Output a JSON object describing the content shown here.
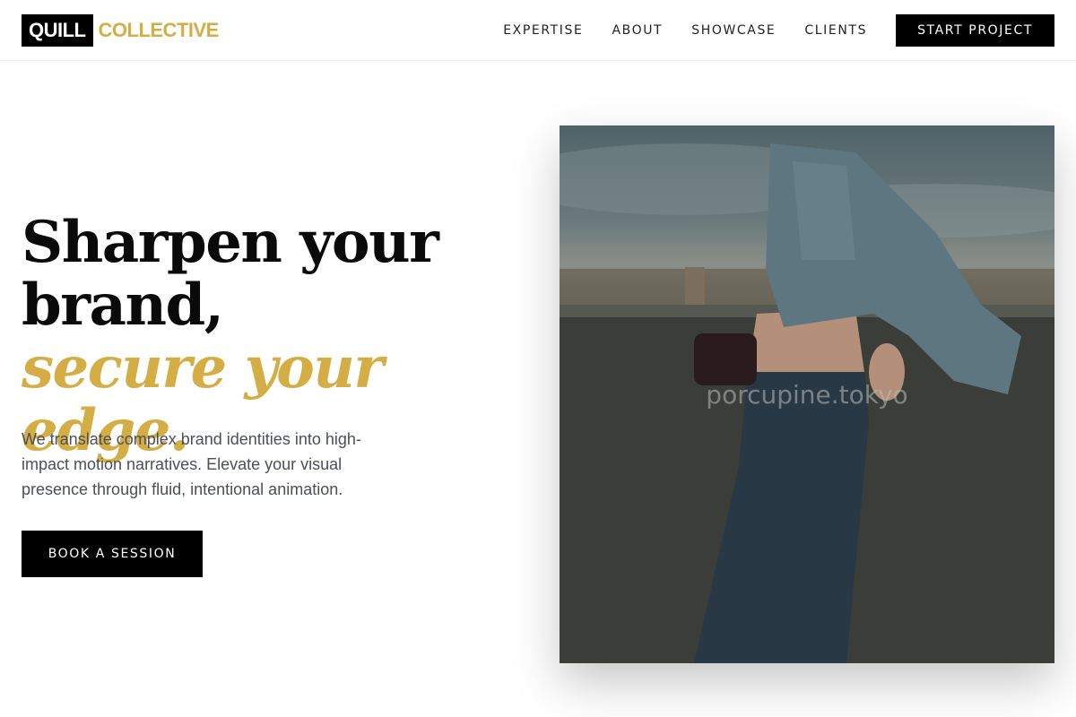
{
  "header": {
    "logo_box": "QUILL",
    "logo_word": "COLLECTIVE",
    "nav": [
      "EXPERTISE",
      "ABOUT",
      "SHOWCASE",
      "CLIENTS"
    ],
    "cta": "START PROJECT"
  },
  "hero": {
    "title_line1": "Sharpen your",
    "title_line2": "brand,",
    "title_accent": "secure your edge.",
    "subtitle": "We translate complex brand identities into high-impact motion narratives. Elevate your visual presence through fluid, intentional animation.",
    "cta": "BOOK A SESSION",
    "image_watermark": "porcupine.tokyo"
  },
  "colors": {
    "accent": "#d4ae45",
    "primary": "#000000",
    "text_muted": "#4a4f58"
  }
}
